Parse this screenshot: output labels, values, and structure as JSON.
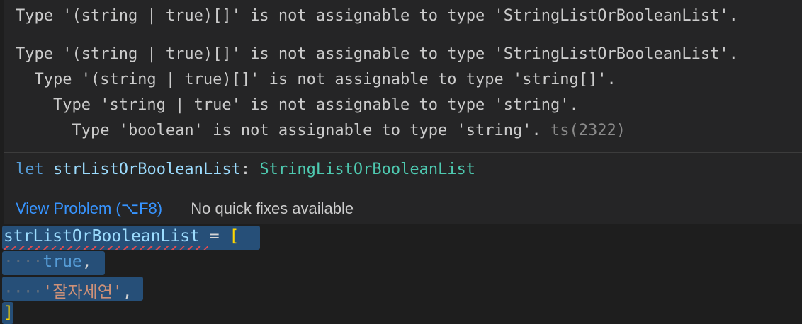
{
  "hover": {
    "summary": "Type '(string | true)[]' is not assignable to type 'StringListOrBooleanList'.",
    "details": [
      "Type '(string | true)[]' is not assignable to type 'StringListOrBooleanList'.",
      "  Type '(string | true)[]' is not assignable to type 'string[]'.",
      "    Type 'string | true' is not assignable to type 'string'.",
      "      Type 'boolean' is not assignable to type 'string'."
    ],
    "error_code": "ts(2322)",
    "signature": {
      "keyword": "let",
      "name": "strListOrBooleanList",
      "colon": ": ",
      "type": "StringListOrBooleanList"
    },
    "status": {
      "view_problem": "View Problem (⌥F8)",
      "no_fixes": "No quick fixes available"
    }
  },
  "editor": {
    "lines": {
      "l1_var": "strListOrBooleanList",
      "l1_eq": " = ",
      "l1_open": "[",
      "indent": "····",
      "l2_value": "true",
      "l2_comma": ",",
      "l3_value": "'잘자세연'",
      "l3_comma": ",",
      "l4_close": "]"
    }
  },
  "colors": {
    "link": "#3794ff",
    "selection": "#264f78",
    "error": "#f14c4c",
    "type": "#4ec9b0"
  }
}
